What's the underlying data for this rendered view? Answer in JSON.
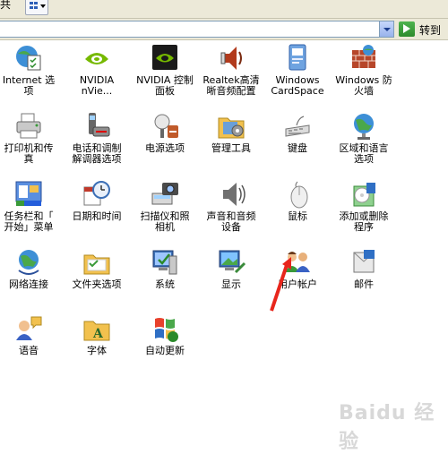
{
  "toolbar": {
    "left_text": "共",
    "view_icon": "view-grid-icon"
  },
  "address": {
    "value": "",
    "go_label": "转到"
  },
  "items": [
    {
      "label": "Internet 选\n项",
      "icon": "internet-options-icon"
    },
    {
      "label": "NVIDIA\nnVie...",
      "icon": "nvidia-logo-icon"
    },
    {
      "label": "NVIDIA 控制\n面板",
      "icon": "nvidia-panel-icon"
    },
    {
      "label": "Realtek高清\n晰音频配置",
      "icon": "speaker-icon"
    },
    {
      "label": "Windows\nCardSpace",
      "icon": "cardspace-icon"
    },
    {
      "label": "Windows 防\n火墙",
      "icon": "firewall-icon"
    },
    {
      "label": "打印机和传\n真",
      "icon": "printer-icon"
    },
    {
      "label": "电话和调制\n解调器选项",
      "icon": "phone-modem-icon"
    },
    {
      "label": "电源选项",
      "icon": "power-icon"
    },
    {
      "label": "管理工具",
      "icon": "admin-tools-icon"
    },
    {
      "label": "键盘",
      "icon": "keyboard-icon"
    },
    {
      "label": "区域和语言\n选项",
      "icon": "globe-icon"
    },
    {
      "label": "任务栏和「\n开始」菜单",
      "icon": "taskbar-icon"
    },
    {
      "label": "日期和时间",
      "icon": "calendar-clock-icon"
    },
    {
      "label": "扫描仪和照\n相机",
      "icon": "scanner-camera-icon"
    },
    {
      "label": "声音和音频\n设备",
      "icon": "sound-icon"
    },
    {
      "label": "鼠标",
      "icon": "mouse-icon"
    },
    {
      "label": "添加或删除\n程序",
      "icon": "add-remove-icon"
    },
    {
      "label": "网络连接",
      "icon": "network-icon"
    },
    {
      "label": "文件夹选项",
      "icon": "folder-options-icon"
    },
    {
      "label": "系统",
      "icon": "system-icon"
    },
    {
      "label": "显示",
      "icon": "display-icon"
    },
    {
      "label": "用户帐户",
      "icon": "users-icon"
    },
    {
      "label": "邮件",
      "icon": "mail-icon"
    },
    {
      "label": "语音",
      "icon": "speech-icon"
    },
    {
      "label": "字体",
      "icon": "fonts-folder-icon"
    },
    {
      "label": "自动更新",
      "icon": "windows-update-icon"
    }
  ],
  "annotation": {
    "arrow_color": "#e8261c"
  },
  "watermark": {
    "text": "Baidu 经验"
  }
}
